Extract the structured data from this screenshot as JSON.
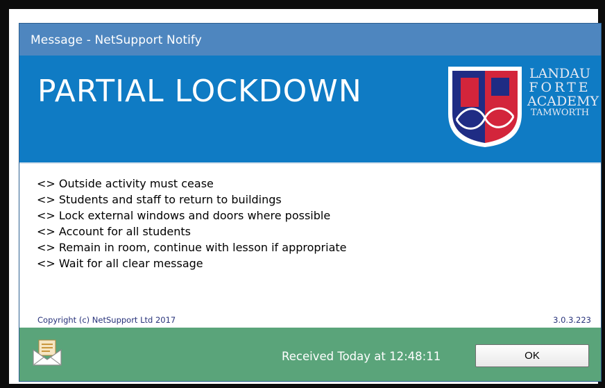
{
  "window": {
    "title": "Message - NetSupport Notify"
  },
  "banner": {
    "headline": "PARTIAL LOCKDOWN",
    "logo": {
      "lines": [
        "LANDAU",
        "FORTE",
        "ACADEMY",
        "TAMWORTH"
      ],
      "colors": {
        "blue": "#1f2c84",
        "red": "#d3253b",
        "white": "#ffffff"
      }
    }
  },
  "message": {
    "lines": [
      "<> Outside activity must cease",
      "<> Students and staff to return to buildings",
      "<> Lock external windows and doors where possible",
      "<> Account for all students",
      "<> Remain in room, continue with lesson if appropriate",
      "<> Wait for all clear message"
    ]
  },
  "info": {
    "copyright": "Copyright (c) NetSupport Ltd 2017",
    "version": "3.0.3.223"
  },
  "footer": {
    "icon": "envelope-icon",
    "received": "Received Today at 12:48:11",
    "ok_label": "OK"
  },
  "colors": {
    "titlebar": "#4e86bf",
    "banner": "#0f7bc4",
    "footer": "#5aa47a",
    "text_link": "#27327a"
  }
}
